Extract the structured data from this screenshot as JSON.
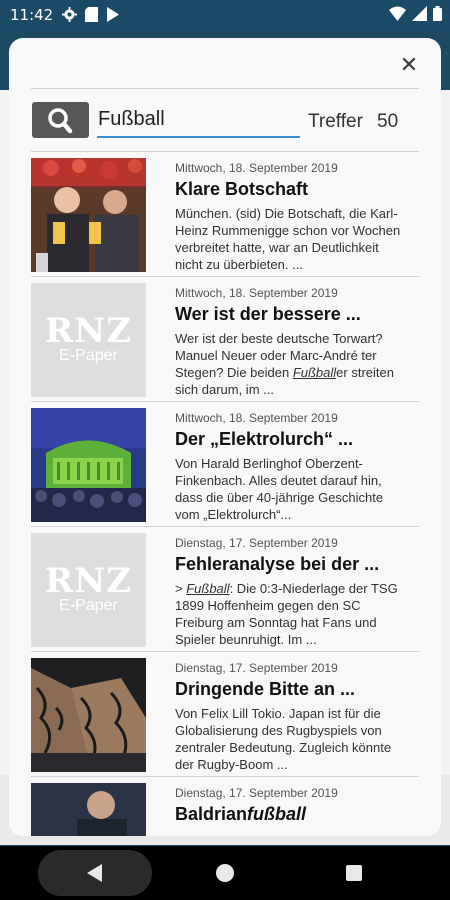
{
  "status_bar": {
    "time": "11:42",
    "left_icons": [
      "gear-icon",
      "sd-card-icon",
      "play-store-icon"
    ],
    "right_icons": [
      "wifi-icon",
      "signal-icon",
      "battery-icon"
    ]
  },
  "dialog": {
    "close_icon": "close-icon",
    "search": {
      "icon": "search-icon",
      "value": "Fußball",
      "hits_label": "Treffer",
      "hits_count": "50"
    },
    "results": [
      {
        "date": "Mittwoch, 18. September 2019",
        "title": "Klare Botschaft",
        "teaser": [
          "München. (sid) Die Botschaft, die Karl-Heinz Rummenigge schon vor Wochen verbreitet hatte, war an Deutlichkeit nicht zu überbieten. ..."
        ],
        "thumb": "photo"
      },
      {
        "date": "Mittwoch, 18. September 2019",
        "title": "Wer ist der bessere ...",
        "teaser": [
          "Wer ist der beste deutsche Torwart? Manuel Neuer oder Marc-André ter Stegen? Die beiden ",
          "Fußball",
          "er streiten sich darum, im ..."
        ],
        "thumb": "rnz",
        "thumb_logo": "RNZ",
        "thumb_sub": "E-Paper"
      },
      {
        "date": "Mittwoch, 18. September 2019",
        "title": "Der „Elektrolurch“ ...",
        "teaser": [
          "Von Harald Berlinghof Oberzent-Finkenbach. Alles deutet darauf hin, dass die über 40-jährige Geschichte vom „Elektrolurch“..."
        ],
        "thumb": "concert"
      },
      {
        "date": "Dienstag, 17. September 2019",
        "title": "Fehleranalyse bei der ...",
        "teaser": [
          "> ",
          "Fußball",
          ": Die 0:3-Niederlage der TSG 1899 Hoffenheim gegen den SC Freiburg am Sonntag hat Fans und Spieler beunruhigt. Im ..."
        ],
        "thumb": "rnz",
        "thumb_logo": "RNZ",
        "thumb_sub": "E-Paper"
      },
      {
        "date": "Dienstag, 17. September 2019",
        "title": "Dringende Bitte an ...",
        "teaser": [
          "Von Felix Lill Tokio. Japan ist für die Globalisierung des Rugbyspiels von zentraler Bedeutung. Zugleich könnte der Rugby-Boom ..."
        ],
        "thumb": "tattoo"
      },
      {
        "date": "Dienstag, 17. September 2019",
        "title_plain": "Baldrian",
        "title_em": "fußball",
        "thumb": "portrait"
      }
    ]
  },
  "colors": {
    "header_bg": "#1f4a63",
    "accent_underline": "#3a8fd0",
    "search_button": "#575757"
  }
}
